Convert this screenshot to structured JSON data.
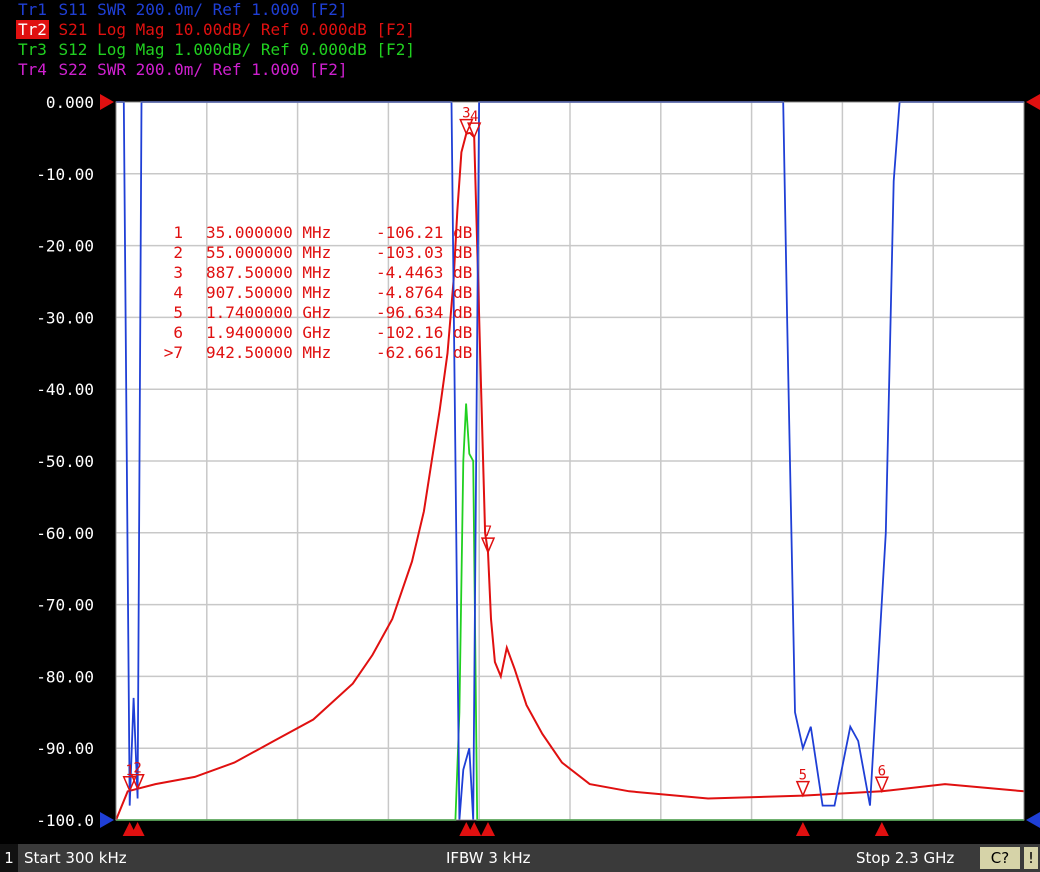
{
  "traces": [
    {
      "id": "Tr1",
      "param": "S11",
      "text": "SWR 200.0m/ Ref 1.000 [F2]",
      "color": "#1f3fd6"
    },
    {
      "id": "Tr2",
      "param": "S21",
      "text": "Log Mag 10.00dB/ Ref 0.000dB [F2]",
      "color": "#e01010",
      "active": true
    },
    {
      "id": "Tr3",
      "param": "S12",
      "text": "Log Mag 1.000dB/ Ref 0.000dB [F2]",
      "color": "#20d020"
    },
    {
      "id": "Tr4",
      "param": "S22",
      "text": "SWR 200.0m/ Ref 1.000 [F2]",
      "color": "#d020d0"
    }
  ],
  "status": {
    "channel": "1",
    "start": "Start 300 kHz",
    "ifbw": "IFBW 3 kHz",
    "stop": "Stop 2.3 GHz",
    "button": "C?",
    "warn": "!"
  },
  "chart_data": {
    "type": "line",
    "x_unit": "MHz",
    "xlim": [
      0.3,
      2300
    ],
    "ylim": [
      -100,
      0
    ],
    "y_ticks": [
      "0.000",
      "-10.00",
      "-20.00",
      "-30.00",
      "-40.00",
      "-50.00",
      "-60.00",
      "-70.00",
      "-80.00",
      "-90.00",
      "-100.0"
    ],
    "grid": true,
    "markers": [
      {
        "label": "1",
        "freq": "35.000000 MHz",
        "value": "-106.21 dB",
        "x": 35
      },
      {
        "label": "2",
        "freq": "55.000000 MHz",
        "value": "-103.03 dB",
        "x": 55
      },
      {
        "label": "3",
        "freq": "887.50000 MHz",
        "value": "-4.4463 dB",
        "x": 887.5
      },
      {
        "label": "4",
        "freq": "907.50000 MHz",
        "value": "-4.8764 dB",
        "x": 907.5
      },
      {
        "label": "5",
        "freq": "1.7400000 GHz",
        "value": "-96.634 dB",
        "x": 1740
      },
      {
        "label": "6",
        "freq": "1.9400000 GHz",
        "value": "-102.16 dB",
        "x": 1940
      },
      {
        "label": ">7",
        "freq": "942.50000 MHz",
        "value": "-62.661 dB",
        "x": 942.5
      }
    ],
    "series": [
      {
        "param": "S21",
        "color": "#e01010",
        "points": [
          [
            0.3,
            -100
          ],
          [
            30,
            -96
          ],
          [
            100,
            -95
          ],
          [
            200,
            -94
          ],
          [
            300,
            -92
          ],
          [
            400,
            -89
          ],
          [
            500,
            -86
          ],
          [
            600,
            -81
          ],
          [
            650,
            -77
          ],
          [
            700,
            -72
          ],
          [
            750,
            -64
          ],
          [
            780,
            -57
          ],
          [
            800,
            -50
          ],
          [
            820,
            -43
          ],
          [
            840,
            -35
          ],
          [
            855,
            -25
          ],
          [
            865,
            -15
          ],
          [
            875,
            -7
          ],
          [
            887.5,
            -4.4
          ],
          [
            897,
            -4.3
          ],
          [
            907.5,
            -4.9
          ],
          [
            915,
            -20
          ],
          [
            925,
            -40
          ],
          [
            935,
            -60
          ],
          [
            942.5,
            -62.7
          ],
          [
            950,
            -72
          ],
          [
            960,
            -78
          ],
          [
            975,
            -80
          ],
          [
            990,
            -76
          ],
          [
            1010,
            -79
          ],
          [
            1040,
            -84
          ],
          [
            1080,
            -88
          ],
          [
            1130,
            -92
          ],
          [
            1200,
            -95
          ],
          [
            1300,
            -96
          ],
          [
            1500,
            -97
          ],
          [
            1740,
            -96.6
          ],
          [
            1940,
            -96
          ],
          [
            2100,
            -95
          ],
          [
            2300,
            -96
          ]
        ]
      },
      {
        "param": "S11",
        "color": "#1f3fd6",
        "points": [
          [
            0.3,
            0
          ],
          [
            20,
            0
          ],
          [
            35,
            -98
          ],
          [
            45,
            -83
          ],
          [
            55,
            -97
          ],
          [
            65,
            0
          ],
          [
            850,
            0
          ],
          [
            870,
            -100
          ],
          [
            880,
            -93
          ],
          [
            895,
            -90
          ],
          [
            905,
            -100
          ],
          [
            920,
            0
          ],
          [
            1690,
            0
          ],
          [
            1700,
            -30
          ],
          [
            1720,
            -85
          ],
          [
            1740,
            -90
          ],
          [
            1760,
            -87
          ],
          [
            1790,
            -98
          ],
          [
            1820,
            -98
          ],
          [
            1860,
            -87
          ],
          [
            1880,
            -89
          ],
          [
            1910,
            -98
          ],
          [
            1950,
            -60
          ],
          [
            1970,
            -11
          ],
          [
            1985,
            0
          ],
          [
            2300,
            0
          ]
        ]
      },
      {
        "param": "S12",
        "color": "#20d020",
        "points": [
          [
            0.3,
            -100
          ],
          [
            860,
            -100
          ],
          [
            870,
            -85
          ],
          [
            880,
            -50
          ],
          [
            887,
            -42
          ],
          [
            895,
            -49
          ],
          [
            905,
            -50
          ],
          [
            915,
            -100
          ],
          [
            2300,
            -100
          ]
        ]
      }
    ]
  }
}
